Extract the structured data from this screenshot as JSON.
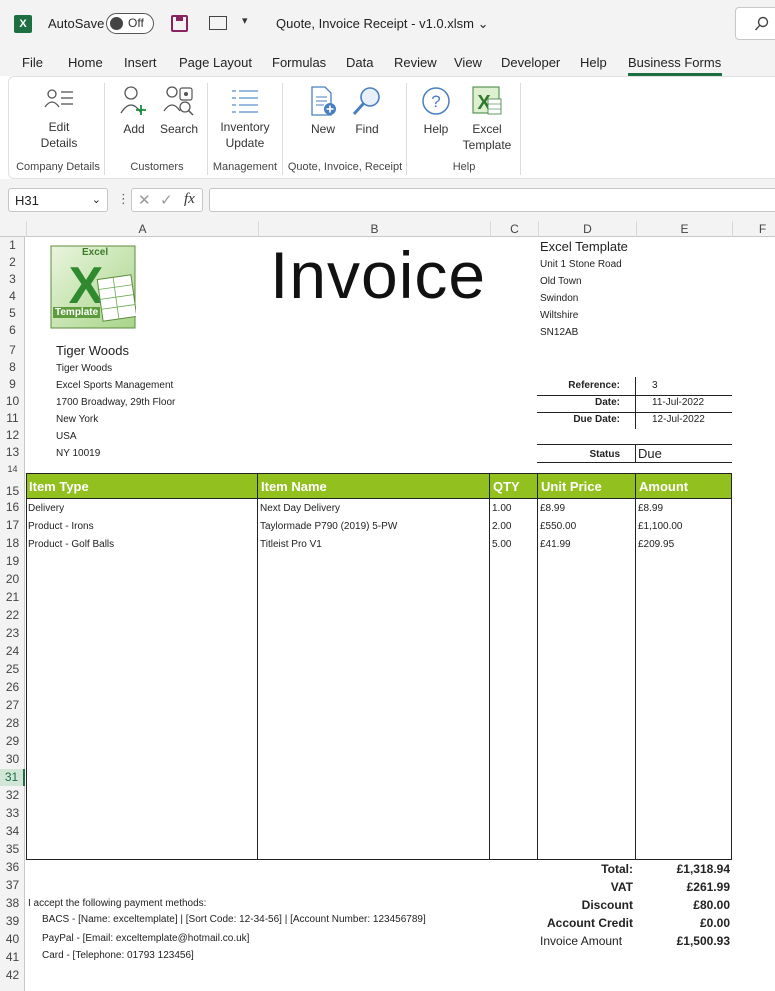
{
  "titlebar": {
    "app_badge": "X",
    "autosave_label": "AutoSave",
    "autosave_state": "Off",
    "filename": "Quote, Invoice Receipt - v1.0.xlsm"
  },
  "tabs": [
    "File",
    "Home",
    "Insert",
    "Page Layout",
    "Formulas",
    "Data",
    "Review",
    "View",
    "Developer",
    "Help",
    "Business Forms"
  ],
  "active_tab": "Business Forms",
  "ribbon": {
    "edit_details": "Edit\nDetails",
    "add": "Add",
    "search": "Search",
    "inventory_update": "Inventory\nUpdate",
    "new": "New",
    "find": "Find",
    "help": "Help",
    "excel_template": "Excel\nTemplate",
    "groups": {
      "company_details": "Company Details",
      "customers": "Customers",
      "management": "Management",
      "quote": "Quote, Invoice, Receipt",
      "help": "Help"
    }
  },
  "formula_bar": {
    "name_box": "H31",
    "fx": "fx",
    "formula": ""
  },
  "columns": [
    "A",
    "B",
    "C",
    "D",
    "E",
    "F"
  ],
  "rows": [
    "1",
    "2",
    "3",
    "4",
    "5",
    "6",
    "7",
    "8",
    "9",
    "10",
    "11",
    "12",
    "13",
    "14",
    "15",
    "16",
    "17",
    "18",
    "19",
    "20",
    "21",
    "22",
    "23",
    "24",
    "25",
    "26",
    "27",
    "28",
    "29",
    "30",
    "31",
    "32",
    "33",
    "34",
    "35",
    "36",
    "37",
    "38",
    "39",
    "40",
    "41",
    "42"
  ],
  "selected_row": "31",
  "sheet": {
    "logo_top": "Excel",
    "logo_bottom": "Template",
    "title": "Invoice",
    "company": {
      "name": "Excel Template",
      "address1": "Unit 1 Stone Road",
      "address2": "Old Town",
      "city": "Swindon",
      "county": "Wiltshire",
      "postcode": "SN12AB"
    },
    "customer": {
      "heading": "Tiger Woods",
      "name": "Tiger Woods",
      "company": "Excel Sports Management",
      "address": "1700 Broadway, 29th Floor",
      "city": "New York",
      "country": "USA",
      "zip": "NY 10019"
    },
    "meta": {
      "reference_label": "Reference:",
      "reference": "3",
      "date_label": "Date:",
      "date": "11-Jul-2022",
      "due_label": "Due Date:",
      "due": "12-Jul-2022",
      "status_label": "Status",
      "status": "Due"
    },
    "table": {
      "headers": [
        "Item Type",
        "Item Name",
        "QTY",
        "Unit Price",
        "Amount"
      ],
      "rows": [
        [
          "Delivery",
          "Next Day Delivery",
          "1.00",
          "£8.99",
          "£8.99"
        ],
        [
          "Product - Irons",
          "Taylormade P790 (2019) 5-PW",
          "2.00",
          "£550.00",
          "£1,100.00"
        ],
        [
          "Product - Golf Balls",
          "Titleist Pro V1",
          "5.00",
          "£41.99",
          "£209.95"
        ]
      ]
    },
    "totals": {
      "total_label": "Total:",
      "total": "£1,318.94",
      "vat_label": "VAT",
      "vat": "£261.99",
      "discount_label": "Discount",
      "discount": "£80.00",
      "credit_label": "Account Credit",
      "credit": "£0.00",
      "invoice_label": "Invoice Amount",
      "invoice": "£1,500.93"
    },
    "payment": {
      "intro": "I accept the following payment methods:",
      "bacs": "BACS - [Name: exceltemplate]  |  [Sort Code: 12-34-56]  |  [Account Number: 123456789]",
      "paypal": "PayPal - [Email: exceltemplate@hotmail.co.uk]",
      "card": "Card - [Telephone: 01793 123456]"
    }
  }
}
